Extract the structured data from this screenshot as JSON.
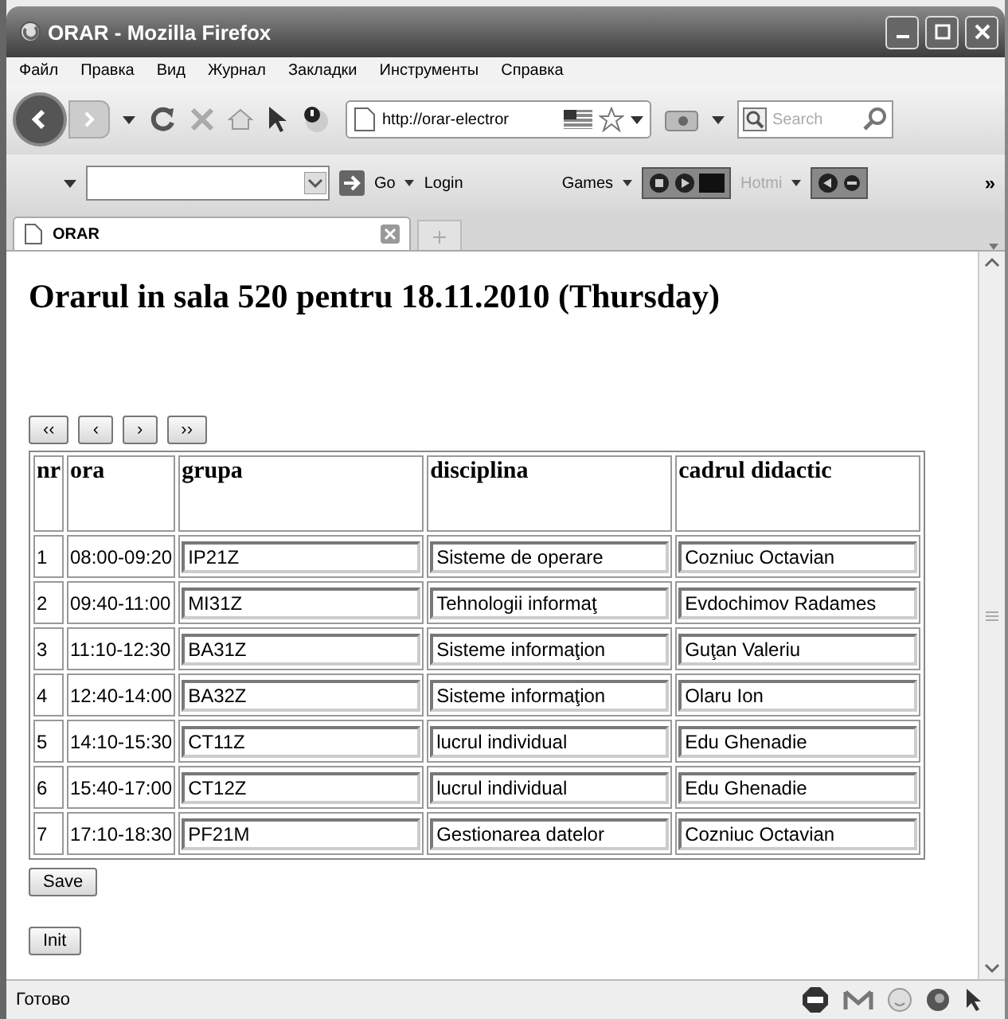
{
  "window": {
    "title": "ORAR - Mozilla Firefox"
  },
  "menu": [
    "Файл",
    "Правка",
    "Вид",
    "Журнал",
    "Закладки",
    "Инструменты",
    "Справка"
  ],
  "nav_toolbar": {
    "url": "http://orar-electror",
    "search_placeholder": "Search"
  },
  "bookmarks_toolbar": {
    "items": [
      {
        "kind": "go",
        "label": "Go",
        "disabled": false
      },
      {
        "kind": "link",
        "label": "Login",
        "disabled": false
      },
      {
        "kind": "menu",
        "label": "Games",
        "disabled": false
      },
      {
        "kind": "menu",
        "label": "Hotmi",
        "disabled": true
      }
    ],
    "overflow": "»"
  },
  "tabs": [
    {
      "label": "ORAR",
      "selected": true
    }
  ],
  "page": {
    "heading": "Orarul in sala 520 pentru 18.11.2010 (Thursday)",
    "nav_buttons": [
      "‹‹",
      "‹",
      "›",
      "››"
    ],
    "table": {
      "columns": [
        "nr",
        "ora",
        "grupa",
        "disciplina",
        "cadrul didactic"
      ],
      "rows": [
        {
          "nr": "1",
          "ora": "08:00-09:20",
          "grupa": "IP21Z",
          "disciplina": "Sisteme de operare",
          "cadrul_didactic": "Cozniuc Octavian"
        },
        {
          "nr": "2",
          "ora": "09:40-11:00",
          "grupa": "MI31Z",
          "disciplina": "Tehnologii informaţ",
          "cadrul_didactic": "Evdochimov Radames"
        },
        {
          "nr": "3",
          "ora": "11:10-12:30",
          "grupa": "BA31Z",
          "disciplina": "Sisteme informaţion",
          "cadrul_didactic": "Guţan Valeriu"
        },
        {
          "nr": "4",
          "ora": "12:40-14:00",
          "grupa": "BA32Z",
          "disciplina": "Sisteme informaţion",
          "cadrul_didactic": "Olaru Ion"
        },
        {
          "nr": "5",
          "ora": "14:10-15:30",
          "grupa": "CT11Z",
          "disciplina": "lucrul individual",
          "cadrul_didactic": "Edu Ghenadie"
        },
        {
          "nr": "6",
          "ora": "15:40-17:00",
          "grupa": "CT12Z",
          "disciplina": "lucrul individual",
          "cadrul_didactic": "Edu Ghenadie"
        },
        {
          "nr": "7",
          "ora": "17:10-18:30",
          "grupa": "PF21M",
          "disciplina": "Gestionarea datelor",
          "cadrul_didactic": "Cozniuc Octavian"
        }
      ]
    },
    "buttons": [
      "Save",
      "Init"
    ]
  },
  "status_bar": {
    "text": "Готово"
  }
}
